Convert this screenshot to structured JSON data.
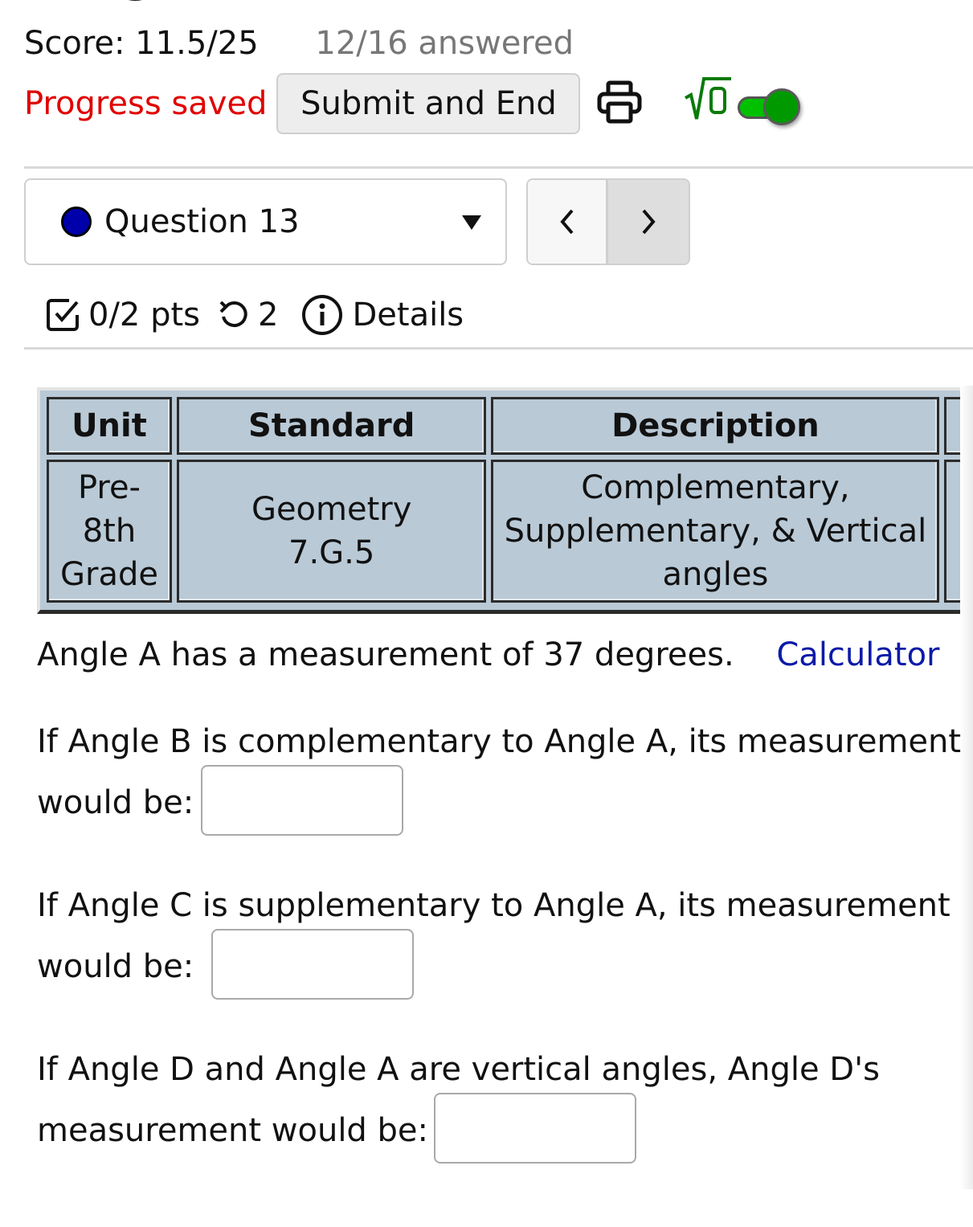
{
  "header": {
    "title_fragment": "g",
    "score": "Score: 11.5/25",
    "answered": "12/16 answered",
    "progress_status": "Progress saved",
    "submit_label": "Submit and End",
    "math_toggle_on": true
  },
  "colors": {
    "progress_saved": "#e00000",
    "link": "#0a1aa8",
    "toggle_on": "#00c000",
    "question_dot": "#0000aa",
    "table_bg": "#b9c9d6"
  },
  "question_nav": {
    "selected": "Question 13",
    "prev_icon": "chevron-left",
    "next_icon": "chevron-right"
  },
  "question_meta": {
    "points": "0/2 pts",
    "attempts": "2",
    "details_label": "Details"
  },
  "standards_table": {
    "headers": [
      "Unit",
      "Standard",
      "Description"
    ],
    "rows": [
      [
        "Pre-8th Grade",
        "Geometry 7.G.5",
        "Complementary, Supplementary, & Vertical angles"
      ]
    ]
  },
  "question": {
    "intro": "Angle A has a measurement of 37 degrees.",
    "calculator_link": "Calculator",
    "parts": [
      {
        "line1": "If Angle B is complementary to Angle A, its measurement",
        "line2": "would be:",
        "value": ""
      },
      {
        "line1": "If Angle C is supplementary to Angle A, its measurement",
        "line2": "would be:",
        "value": ""
      },
      {
        "line1": "If Angle D and Angle A are vertical angles, Angle D's",
        "line2": "measurement would be:",
        "value": ""
      }
    ]
  }
}
